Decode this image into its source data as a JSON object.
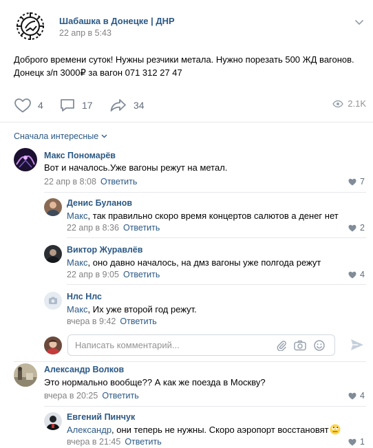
{
  "post": {
    "group_name": "Шабашка в Донецке | ДНР",
    "time": "22 апр в 5:43",
    "text_line1": "Доброго времени суток! Нужны резчики метала. Нужно порезать 500 ЖД вагонов.",
    "text_line2": "Донецк з/п 3000₽ за вагон 071 312 27 47",
    "likes": "4",
    "comments": "17",
    "shares": "34",
    "views": "2.1K"
  },
  "sort_label": "Сначала интересные",
  "comments": [
    {
      "name": "Макс Пономарёв",
      "text": "Вот и началось.Уже вагоны режут на метал.",
      "date": "22 апр в 8:08",
      "reply_label": "Ответить",
      "likes": "7",
      "replies": [
        {
          "name": "Денис Буланов",
          "reply_to": "Макс",
          "text": ", так правильно скоро время концертов салютов а денег нет",
          "date": "22 апр в 8:36",
          "reply_label": "Ответить",
          "likes": "2"
        },
        {
          "name": "Виктор Журавлёв",
          "reply_to": "Макс",
          "text": ", оно давно началось, на дмз вагоны уже полгода режут",
          "date": "22 апр в 9:05",
          "reply_label": "Ответить",
          "likes": "4"
        },
        {
          "name": "Нлс Нлс",
          "reply_to": "Макс",
          "text": ", Их уже второй год режут.",
          "date": "вчера в 9:42",
          "reply_label": "Ответить",
          "likes": ""
        }
      ]
    },
    {
      "name": "Александр Волков",
      "text": "Это нормально вообще?? А как же поезда в Москву?",
      "date": "вчера в 20:25",
      "reply_label": "Ответить",
      "likes": "4",
      "replies": [
        {
          "name": "Евгений Пинчук",
          "reply_to": "Александр",
          "text": ", они теперь не нужны. Скоро аэропорт восстановят",
          "date": "вчера в 21:45",
          "reply_label": "Ответить",
          "likes": "1"
        }
      ]
    }
  ],
  "comment_input": {
    "placeholder": "Написать комментарий...",
    "value": ""
  },
  "colors": {
    "link": "#2a5885",
    "meta": "#828282",
    "icon": "#818c99",
    "divider": "#e7e8ec"
  }
}
